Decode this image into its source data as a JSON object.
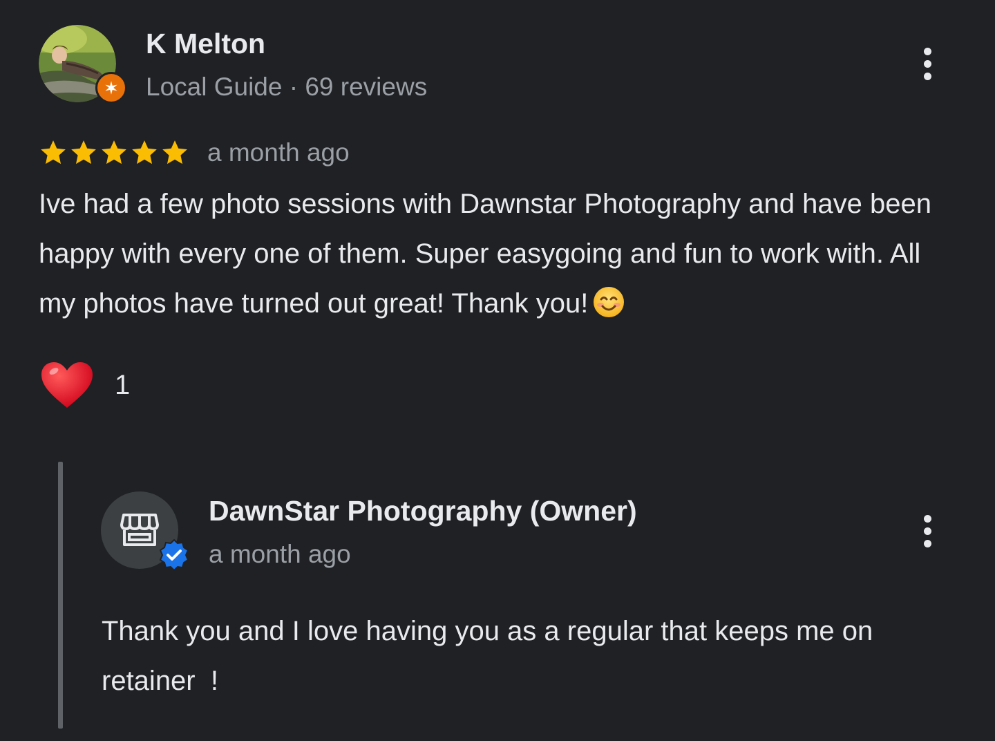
{
  "review": {
    "reviewer_name": "K Melton",
    "reviewer_meta": "Local Guide · 69 reviews",
    "rating": 5,
    "rating_max": 5,
    "time": "a month ago",
    "text": "Ive had a few photo sessions with Dawnstar Photography and have been happy with every one of them. Super easygoing and fun to work with. All my photos have turned out great! Thank you!",
    "text_emoji": "smiling-face-icon",
    "reaction": {
      "icon": "heart-icon",
      "count": "1"
    },
    "more_icon": "more-vert-icon"
  },
  "owner_reply": {
    "owner_name": "DawnStar Photography (Owner)",
    "time": "a month ago",
    "text": "Thank you and I love having you as a regular that keeps me on retainer  !",
    "avatar_icon": "storefront-icon",
    "badge_icon": "verified-check-icon",
    "more_icon": "more-vert-icon"
  },
  "colors": {
    "background": "#202124",
    "primary_text": "#e8eaed",
    "secondary_text": "#9aa0a6",
    "star": "#fbbc04",
    "local_guide_badge": "#e8710a",
    "verified_badge": "#1a73e8",
    "heart": "#e0101f"
  }
}
